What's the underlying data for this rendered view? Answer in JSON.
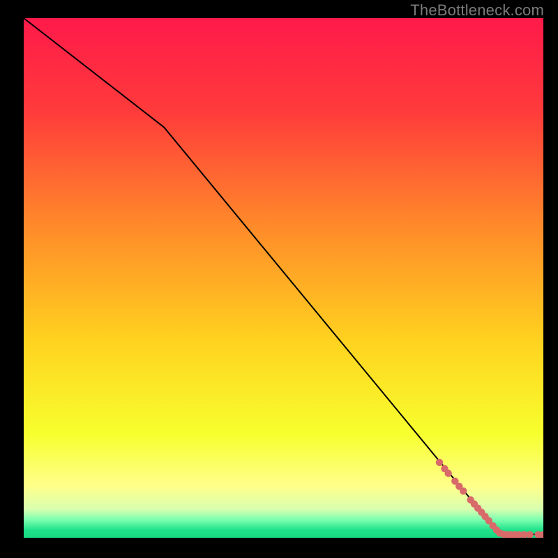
{
  "attribution": "TheBottleneck.com",
  "chart_data": {
    "type": "line",
    "title": "",
    "xlabel": "",
    "ylabel": "",
    "xlim": [
      0,
      100
    ],
    "ylim": [
      0,
      100
    ],
    "background": "rainbow-gradient",
    "gradient_stops": [
      {
        "pos": 0.0,
        "color": "#ff1a4a"
      },
      {
        "pos": 0.18,
        "color": "#ff3b3b"
      },
      {
        "pos": 0.4,
        "color": "#ff8a2a"
      },
      {
        "pos": 0.62,
        "color": "#ffd21f"
      },
      {
        "pos": 0.8,
        "color": "#f7ff2e"
      },
      {
        "pos": 0.9,
        "color": "#ffff8a"
      },
      {
        "pos": 0.945,
        "color": "#d9ffb0"
      },
      {
        "pos": 0.965,
        "color": "#7dffb0"
      },
      {
        "pos": 0.985,
        "color": "#1fe28a"
      },
      {
        "pos": 1.0,
        "color": "#17d983"
      }
    ],
    "series": [
      {
        "name": "curve",
        "color": "#000000",
        "type": "line",
        "points": [
          {
            "x": 0.0,
            "y": 100.0
          },
          {
            "x": 27.0,
            "y": 79.0
          },
          {
            "x": 90.5,
            "y": 2.0
          },
          {
            "x": 93.0,
            "y": 0.8
          },
          {
            "x": 100.0,
            "y": 0.6
          }
        ]
      },
      {
        "name": "markers",
        "color": "#d86a6a",
        "type": "scatter",
        "points": [
          {
            "x": 80.0,
            "y": 14.5
          },
          {
            "x": 81.0,
            "y": 13.3
          },
          {
            "x": 81.7,
            "y": 12.4
          },
          {
            "x": 83.0,
            "y": 10.9
          },
          {
            "x": 83.8,
            "y": 9.9
          },
          {
            "x": 84.6,
            "y": 9.0
          },
          {
            "x": 86.0,
            "y": 7.3
          },
          {
            "x": 86.7,
            "y": 6.5
          },
          {
            "x": 87.4,
            "y": 5.7
          },
          {
            "x": 88.1,
            "y": 4.9
          },
          {
            "x": 88.8,
            "y": 4.1
          },
          {
            "x": 89.5,
            "y": 3.3
          },
          {
            "x": 90.3,
            "y": 2.3
          },
          {
            "x": 91.0,
            "y": 1.5
          },
          {
            "x": 91.6,
            "y": 0.9
          },
          {
            "x": 92.3,
            "y": 0.7
          },
          {
            "x": 93.0,
            "y": 0.6
          },
          {
            "x": 93.7,
            "y": 0.6
          },
          {
            "x": 94.5,
            "y": 0.6
          },
          {
            "x": 95.3,
            "y": 0.6
          },
          {
            "x": 96.3,
            "y": 0.6
          },
          {
            "x": 97.4,
            "y": 0.6
          },
          {
            "x": 99.0,
            "y": 0.6
          },
          {
            "x": 100.0,
            "y": 0.6
          }
        ]
      }
    ]
  }
}
